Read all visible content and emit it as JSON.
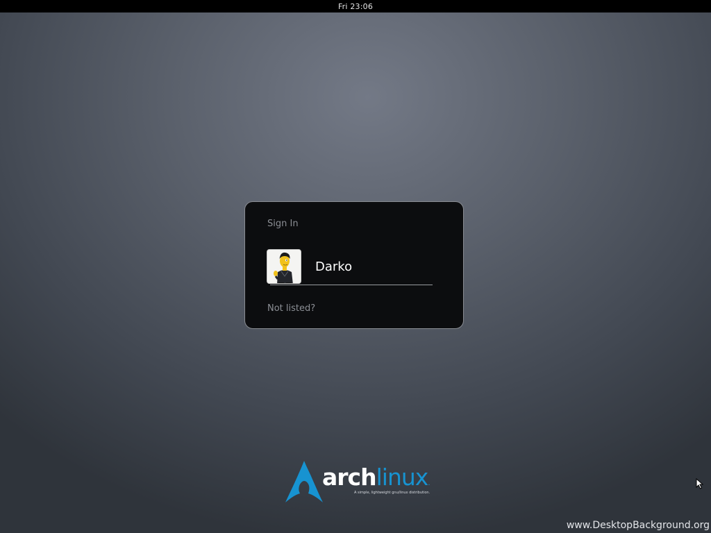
{
  "top_bar": {
    "clock": "Fri 23:06"
  },
  "login": {
    "title": "Sign In",
    "user": {
      "name": "Darko",
      "avatar_icon": "cartoon-avatar"
    },
    "not_listed": "Not listed?"
  },
  "branding": {
    "arch": "arch",
    "linux": "linux",
    "trademark_dot": ".",
    "tagline": "A simple, lightweight gnu/linux distribution.",
    "accent_color": "#1793d1"
  },
  "watermark": "www.DesktopBackground.org",
  "colors": {
    "top_bar": "#000000",
    "dialog_bg": "#0c0d0f",
    "dialog_border": "#8a8d93",
    "muted_text": "#8c8f95"
  }
}
